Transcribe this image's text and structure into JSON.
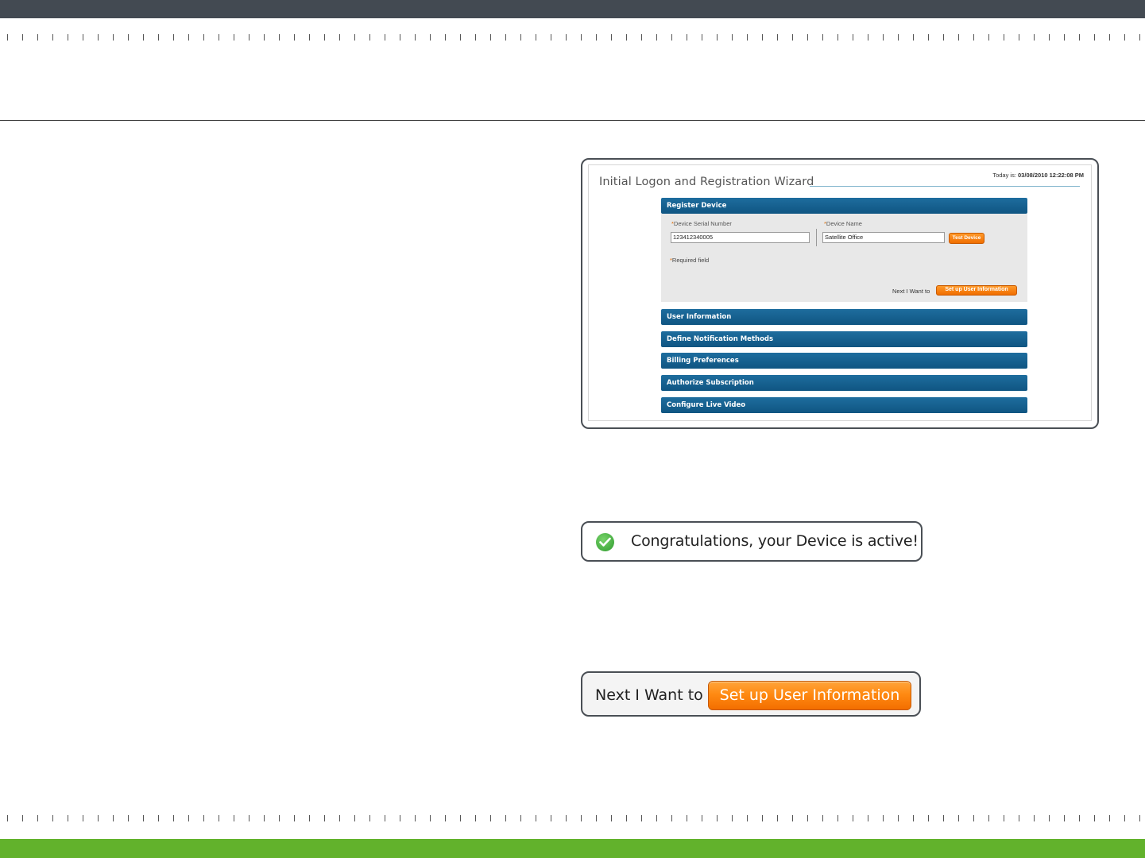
{
  "wizard": {
    "title": "Initial Logon and Registration Wizard",
    "today_label": "Today is:",
    "today_value": "03/08/2010 12:22:08 PM",
    "register": {
      "header": "Register Device",
      "serial_label": "Device Serial Number",
      "serial_value": "123412340005",
      "name_label": "Device Name",
      "name_value": "Satellite Office",
      "required_star": "*",
      "test_button": "Test Device",
      "required_note": "Required field",
      "next_label": "Next I Want to",
      "next_button": "Set up User Information"
    },
    "sections": [
      "User Information",
      "Define Notification Methods",
      "Billing Preferences",
      "Authorize Subscription",
      "Configure Live Video"
    ]
  },
  "congrats": {
    "icon": "checkmark-circle-icon",
    "message": "Congratulations, your Device is active!"
  },
  "next_panel": {
    "label": "Next I Want to",
    "button": "Set up User Information"
  },
  "colors": {
    "top_bar": "#434a52",
    "bottom_bar": "#62b22c",
    "section_blue": "#0f5582",
    "accent_orange": "#f36e00"
  }
}
